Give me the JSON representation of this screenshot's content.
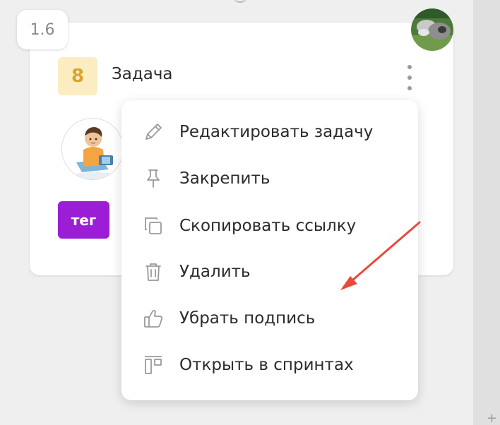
{
  "card": {
    "version": "1.6",
    "points": "8",
    "title": "Задача",
    "tag": "тег"
  },
  "menu": {
    "items": [
      {
        "label": "Редактировать задачу",
        "icon": "pencil-icon"
      },
      {
        "label": "Закрепить",
        "icon": "pin-icon"
      },
      {
        "label": "Скопировать ссылку",
        "icon": "copy-icon"
      },
      {
        "label": "Удалить",
        "icon": "trash-icon"
      },
      {
        "label": "Убрать подпись",
        "icon": "thumbs-up-icon"
      },
      {
        "label": "Открыть в спринтах",
        "icon": "sprints-icon"
      }
    ]
  },
  "colors": {
    "points_bg": "#fbedc1",
    "points_text": "#d9a42c",
    "tag_bg": "#9b1ed6",
    "arrow": "#e84a3c"
  },
  "corner": {
    "plus": "+"
  }
}
